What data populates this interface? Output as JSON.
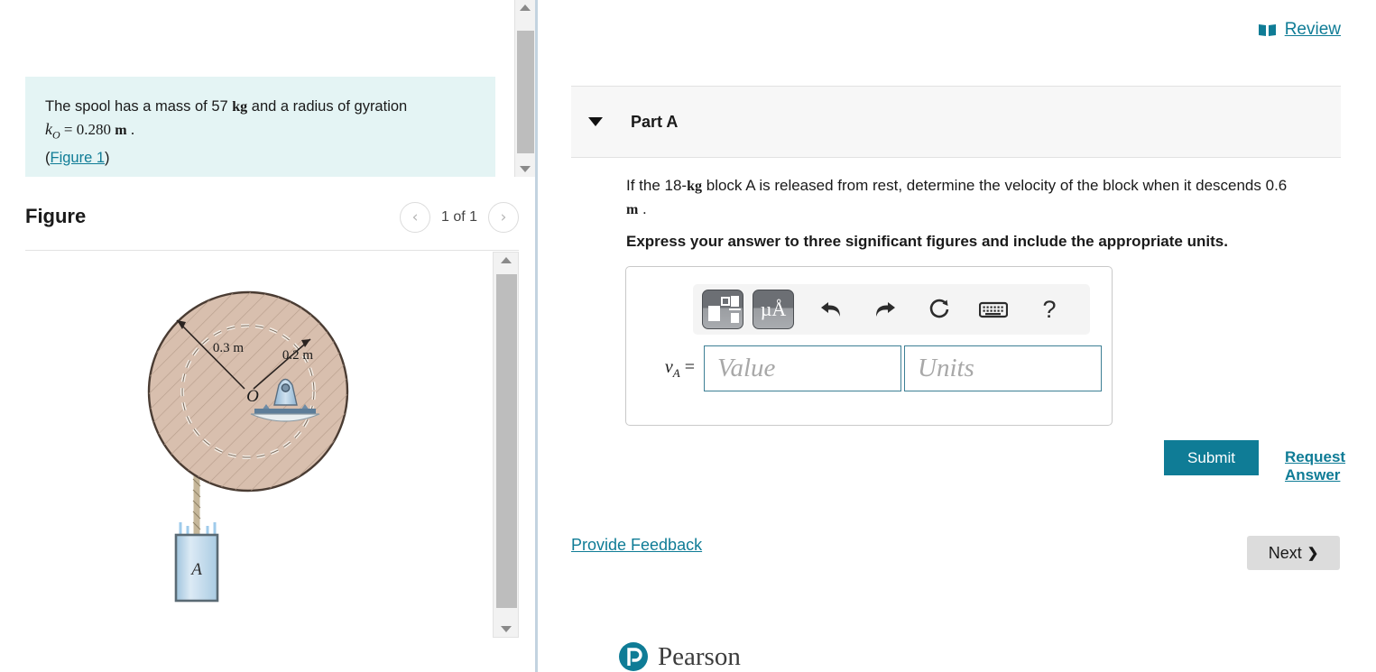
{
  "statement": {
    "line1_a": "The spool has a mass of 57 ",
    "line1_unit": "kg",
    "line1_b": " and a radius of gyration",
    "line2_var": "k",
    "line2_sub": "O",
    "line2_eq": " = ",
    "line2_val": "0.280 ",
    "line2_unit": "m",
    "line2_end": " .",
    "figure_link": "Figure 1",
    "paren_open": "(",
    "paren_close": ")"
  },
  "figure": {
    "title": "Figure",
    "pager_label": "1 of 1",
    "prev_icon": "chevron-left-icon",
    "next_icon": "chevron-right-icon",
    "diagram": {
      "outer_radius_label": "0.3 m",
      "inner_radius_label": "0.2 m",
      "center_label": "O",
      "block_label": "A",
      "spool_fill": "#d8bfae",
      "spool_stroke": "#4a3c33",
      "block_fill": "#bcd9ec",
      "cord_color": "#c6b79a"
    }
  },
  "review": {
    "label": "Review",
    "icon": "book-icon"
  },
  "part": {
    "title": "Part A",
    "caret_icon": "caret-down-icon",
    "question_a": "If the 18-",
    "question_unit1": "kg",
    "question_b": " block A is released from rest, determine the velocity of the block when it descends 0.6 ",
    "question_unit2": "m",
    "question_c": " .",
    "express_instruction": "Express your answer to three significant figures and include the appropriate units."
  },
  "answer": {
    "variable_v": "v",
    "variable_sub": "A",
    "equals": " =",
    "value_placeholder": "Value",
    "value_current": "",
    "units_placeholder": "Units",
    "units_current": "",
    "toolbar": [
      {
        "name": "template-formatting-button",
        "icon": "template-icon",
        "label": ""
      },
      {
        "name": "unit-symbols-button",
        "icon": "micro-angstrom-icon",
        "label": "µÅ"
      },
      {
        "name": "undo-button",
        "icon": "undo-arrow-icon",
        "label": "↶"
      },
      {
        "name": "redo-button",
        "icon": "redo-arrow-icon",
        "label": "↷"
      },
      {
        "name": "reset-button",
        "icon": "reset-circular-arrow-icon",
        "label": "↻"
      },
      {
        "name": "keyboard-button",
        "icon": "keyboard-icon",
        "label": ""
      },
      {
        "name": "help-button",
        "icon": "question-mark-icon",
        "label": "?"
      }
    ]
  },
  "actions": {
    "submit_label": "Submit",
    "request_answer_label": "Request Answer",
    "provide_feedback_label": "Provide Feedback",
    "next_label": "Next",
    "next_chevron": "❯"
  },
  "footer": {
    "brand": "Pearson",
    "brand_icon": "pearson-logo-icon"
  },
  "colors": {
    "accent_teal": "#0f7c96",
    "statement_bg": "#e4f4f4",
    "part_header_bg": "#f7f7f7",
    "next_btn_bg": "#dcdcdc",
    "input_border": "#3d7f95"
  }
}
